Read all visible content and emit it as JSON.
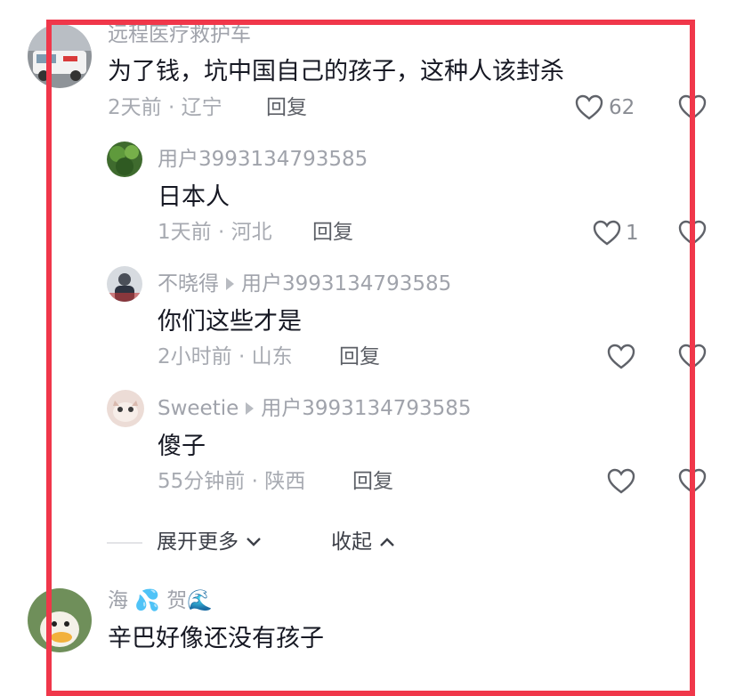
{
  "comments": [
    {
      "username": "远程医疗救护车",
      "text": "为了钱，坑中国自己的孩子，这种人该封杀",
      "meta": "2天前 · 辽宁",
      "reply_label": "回复",
      "likes": "62",
      "replies": [
        {
          "username": "用户3993134793585",
          "reply_to": "",
          "text": "日本人",
          "meta": "1天前 · 河北",
          "reply_label": "回复",
          "likes": "1"
        },
        {
          "username": "不晓得",
          "reply_to": "用户3993134793585",
          "text": "你们这些才是",
          "meta": "2小时前 · 山东",
          "reply_label": "回复",
          "likes": ""
        },
        {
          "username": "Sweetie",
          "reply_to": "用户3993134793585",
          "text": "傻子",
          "meta": "55分钟前 · 陕西",
          "reply_label": "回复",
          "likes": ""
        }
      ],
      "expand_label": "展开更多",
      "collapse_label": "收起"
    },
    {
      "username": "海 💦 贺🌊",
      "text": "辛巴好像还没有孩子"
    }
  ],
  "icons": {
    "like": "heart-outline-icon",
    "reply_arrow": "triangle-right-icon",
    "expand": "chevron-down-icon",
    "collapse": "chevron-up-icon"
  },
  "colors": {
    "highlight_frame": "#f0374a",
    "primary_text": "#161823",
    "secondary_text": "#a7aab1"
  }
}
